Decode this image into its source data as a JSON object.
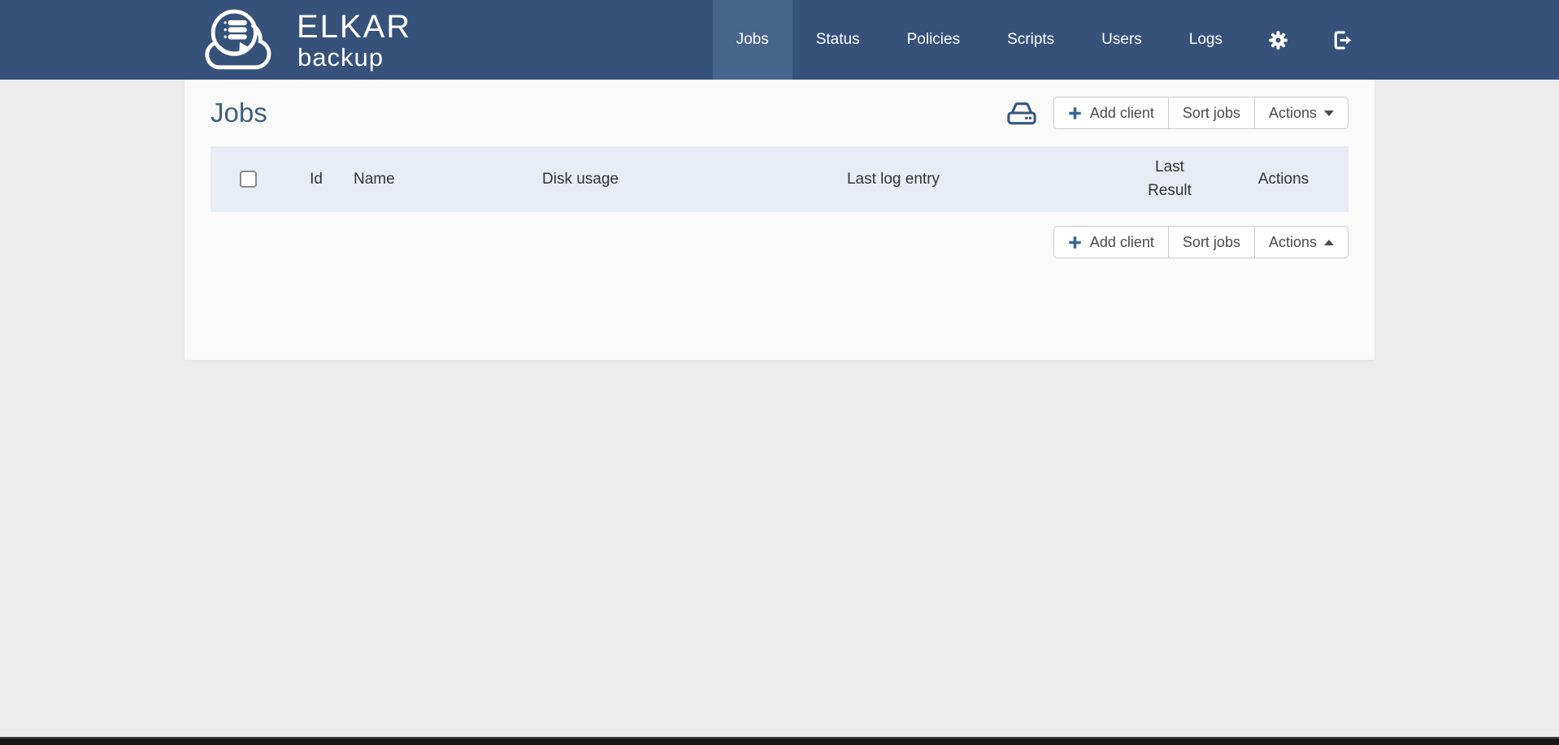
{
  "navbar": {
    "brand_title": "ELKAR",
    "brand_subtitle": "backup",
    "items": [
      {
        "label": "Jobs",
        "active": true
      },
      {
        "label": "Status",
        "active": false
      },
      {
        "label": "Policies",
        "active": false
      },
      {
        "label": "Scripts",
        "active": false
      },
      {
        "label": "Users",
        "active": false
      },
      {
        "label": "Logs",
        "active": false
      }
    ],
    "icons": [
      "gear-icon",
      "sign-out-icon"
    ]
  },
  "main": {
    "title": "Jobs",
    "toolbar": {
      "disk_icon": "hard-drive-icon",
      "plus_icon": "plus-icon",
      "add_client_label": "Add client",
      "sort_jobs_label": "Sort jobs",
      "actions_label": "Actions"
    },
    "table": {
      "columns": {
        "id": "Id",
        "name": "Name",
        "disk_usage": "Disk usage",
        "last_log_entry": "Last log entry",
        "last_result": "Last Result",
        "actions": "Actions"
      },
      "rows": []
    }
  },
  "colors": {
    "navbar_bg": "#36527b",
    "navbar_active_bg": "#48658d",
    "page_bg": "#ececec",
    "panel_bg": "#fafafa",
    "table_header_bg": "#e8ecf4",
    "heading_text": "#3d5f80",
    "accent_blue": "#3b6596",
    "icon_blue": "#34567e",
    "button_text": "#4a4a4a",
    "bottom_bar": "#171717"
  }
}
